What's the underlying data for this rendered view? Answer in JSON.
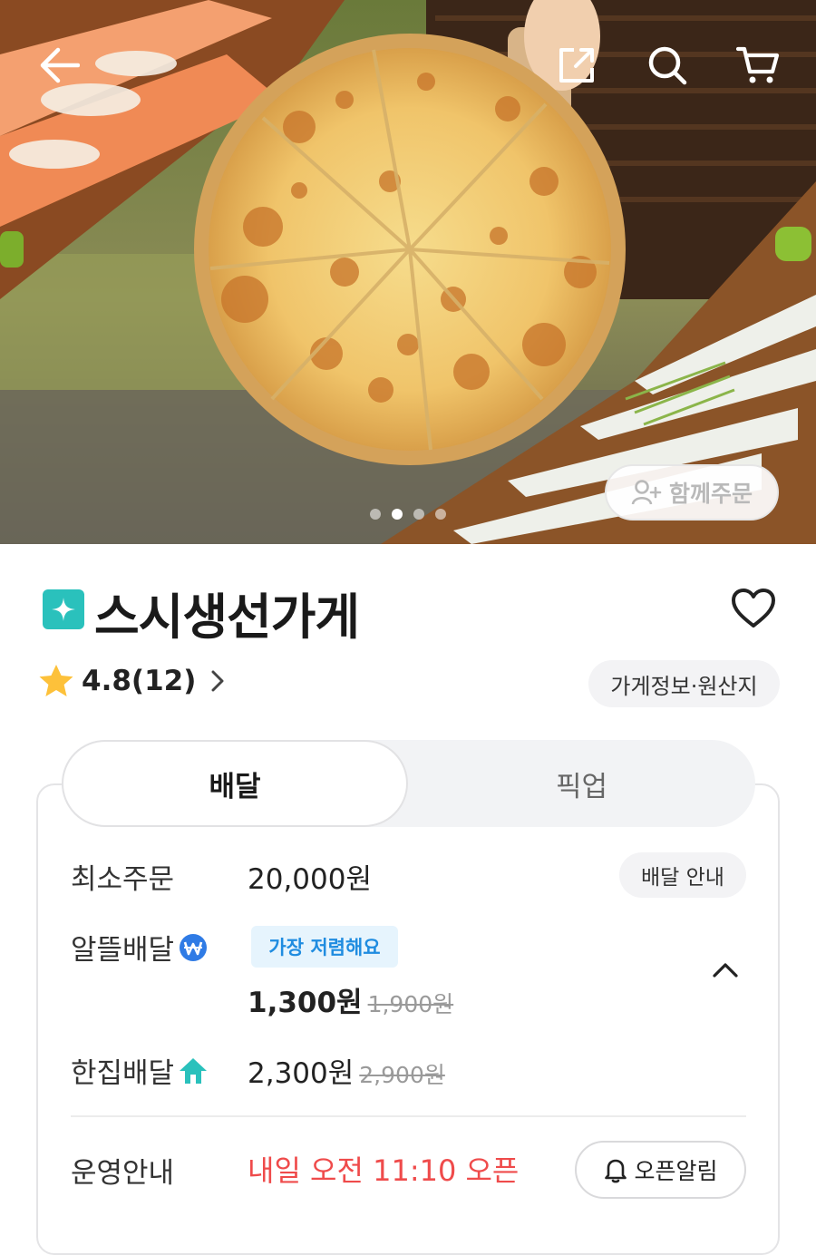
{
  "hero": {
    "image_subject": "pizza-and-sashimi-photo",
    "carousel_total": 4,
    "carousel_active_index": 1,
    "group_order_label": "함께주문"
  },
  "top_bar": {
    "icons": [
      "back-arrow-icon",
      "share-icon",
      "search-icon",
      "cart-icon"
    ]
  },
  "store": {
    "name": "스시생선가게",
    "badge_color": "#2ac1bc",
    "rating": "4.8(12)",
    "info_button": "가게정보·원산지"
  },
  "tabs": {
    "delivery": "배달",
    "pickup": "픽업"
  },
  "delivery": {
    "min_order_label": "최소주문",
    "min_order_value": "20,000원",
    "guide_button": "배달 안내",
    "saver": {
      "label": "알뜰배달",
      "tag": "가장 저렴해요",
      "price": "1,300원",
      "original_price": "1,900원"
    },
    "single": {
      "label": "한집배달",
      "price": "2,300원",
      "original_price": "2,900원"
    },
    "hours_label": "운영안내",
    "hours_value": "내일 오전 11:10 오픈",
    "open_alarm_button": "오픈알림"
  },
  "colors": {
    "accent_teal": "#2ac1bc",
    "open_red": "#ef4b4b",
    "tag_blue": "#1f8ce0"
  }
}
